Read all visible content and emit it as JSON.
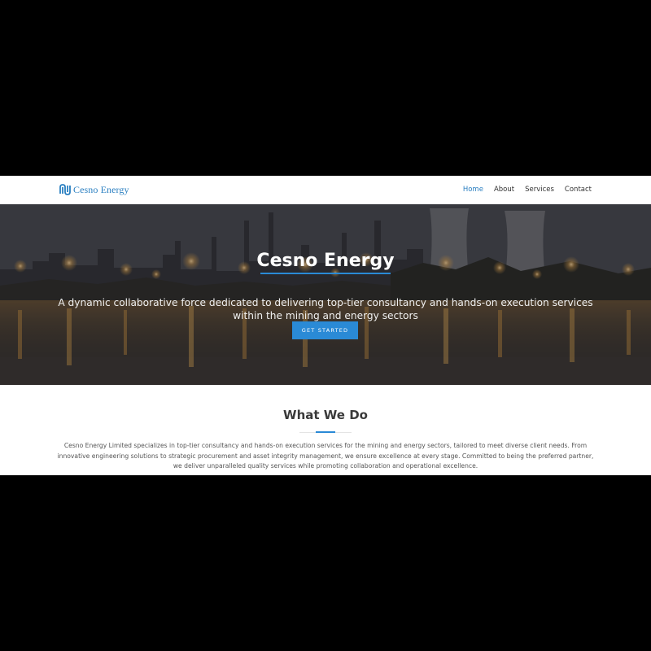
{
  "brand": {
    "name": "Cesno Energy",
    "color": "#2a7fc1"
  },
  "nav": {
    "items": [
      {
        "label": "Home",
        "active": true
      },
      {
        "label": "About",
        "active": false
      },
      {
        "label": "Services",
        "active": false
      },
      {
        "label": "Contact",
        "active": false
      }
    ]
  },
  "hero": {
    "title": "Cesno Energy",
    "subtitle": "A dynamic collaborative force dedicated to delivering top-tier consultancy and hands-on execution services within the mining and energy sectors",
    "cta_label": "GET STARTED",
    "accent": "#2a8ad6"
  },
  "what_we_do": {
    "title": "What We Do",
    "body": "Cesno Energy Limited specializes in top-tier consultancy and hands-on execution services for the mining and energy sectors, tailored to meet diverse client needs. From innovative engineering solutions to strategic procurement and asset integrity management, we ensure excellence at every stage. Committed to being the preferred partner, we deliver unparalleled quality services while promoting collaboration and operational excellence."
  }
}
